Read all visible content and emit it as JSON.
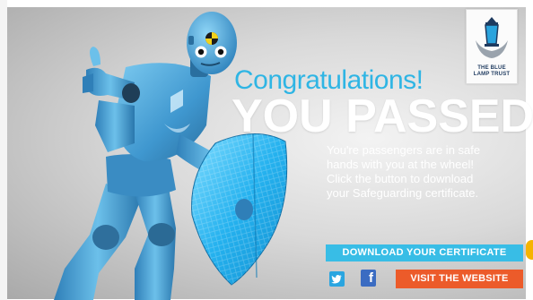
{
  "headline": {
    "congrats": "Congratulations!",
    "title": "YOU PASSED"
  },
  "message": {
    "lines": [
      "You're passengers are in safe",
      "hands with you at the wheel!",
      "Click the button to download",
      "your Safeguarding certificate."
    ]
  },
  "actions": {
    "download_label": "DOWNLOAD YOUR CERTIFICATE",
    "visit_label": "VISIT THE WEBSITE"
  },
  "social": {
    "twitter_icon": "twitter-icon",
    "facebook_icon": "facebook-icon",
    "facebook_glyph": "f"
  },
  "logo": {
    "lines": [
      "THE BLUE",
      "LAMP TRUST"
    ]
  },
  "colors": {
    "accent_blue": "#38bde6",
    "congrats_blue": "#2fb5e4",
    "visit_orange": "#ec5b2a",
    "robot_blue": "#4fa9d8",
    "shield_blue": "#27b4ef",
    "hint_yellow": "#f5b400"
  }
}
